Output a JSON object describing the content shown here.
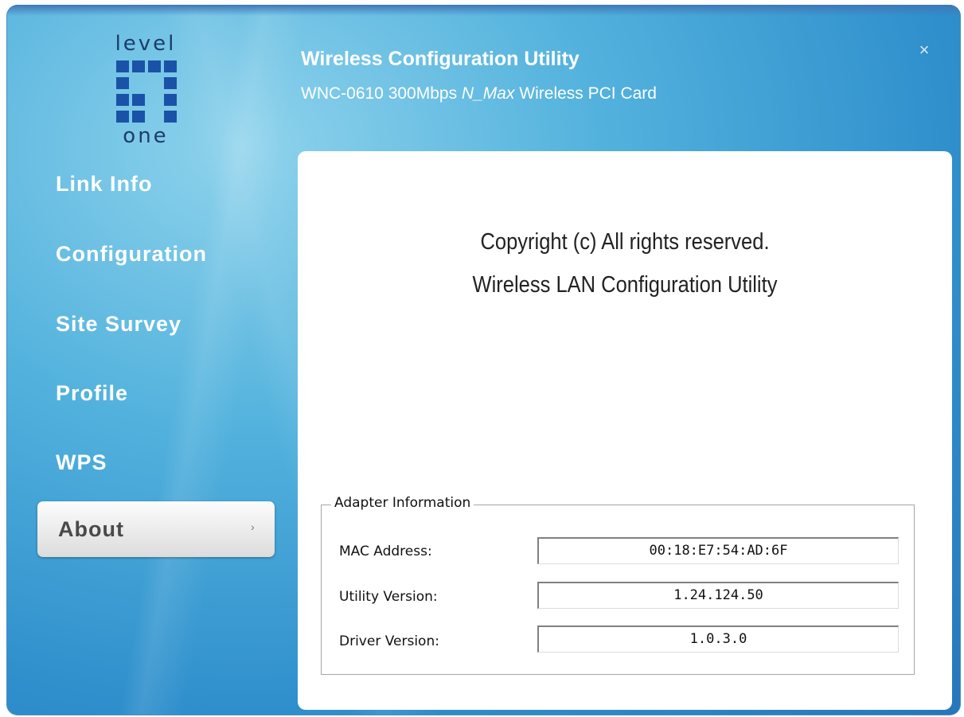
{
  "logo": {
    "top_text": "level",
    "bottom_text": "one"
  },
  "header": {
    "title": "Wireless Configuration Utility",
    "subtitle_prefix": "WNC-0610 300Mbps ",
    "subtitle_italic": "N_Max",
    "subtitle_suffix": " Wireless PCI Card",
    "close_glyph": "×"
  },
  "nav": {
    "items": [
      {
        "label": "Link Info"
      },
      {
        "label": "Configuration"
      },
      {
        "label": "Site Survey"
      },
      {
        "label": "Profile"
      },
      {
        "label": "WPS"
      }
    ],
    "active": {
      "label": "About",
      "arrow": "›"
    }
  },
  "about": {
    "copyright": "Copyright (c)  All rights reserved.",
    "product": "Wireless LAN Configuration Utility"
  },
  "adapter": {
    "legend": "Adapter Information",
    "rows": [
      {
        "label": "MAC Address:",
        "value": "00:18:E7:54:AD:6F"
      },
      {
        "label": "Utility Version:",
        "value": "1.24.124.50"
      },
      {
        "label": "Driver Version:",
        "value": "1.0.3.0"
      }
    ]
  },
  "colors": {
    "window_bg": "#3f9fd6",
    "logo_blue": "#1a52a8",
    "panel_bg": "#ffffff"
  }
}
